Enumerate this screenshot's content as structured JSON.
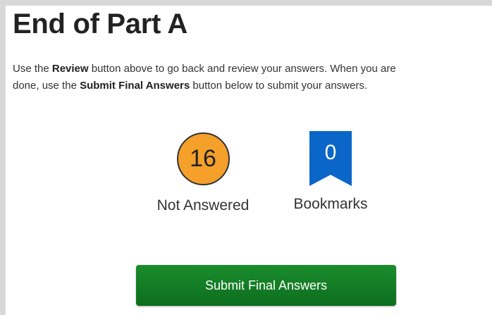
{
  "page": {
    "title": "End of Part A",
    "instructions": {
      "line1_prefix": "Use the ",
      "review_keyword": "Review",
      "line1_suffix": " button above to go back and review your answers. When you are",
      "line2_prefix": "done, use the ",
      "submit_keyword": "Submit Final Answers",
      "line2_suffix": " button below to submit your answers."
    }
  },
  "stats": {
    "not_answered": {
      "count": "16",
      "label": "Not Answered",
      "color": "#f5a02a"
    },
    "bookmarks": {
      "count": "0",
      "label": "Bookmarks",
      "icon": "bookmark-icon",
      "color": "#0a66c8"
    }
  },
  "actions": {
    "submit_label": "Submit Final Answers",
    "submit_color": "#127a25"
  }
}
